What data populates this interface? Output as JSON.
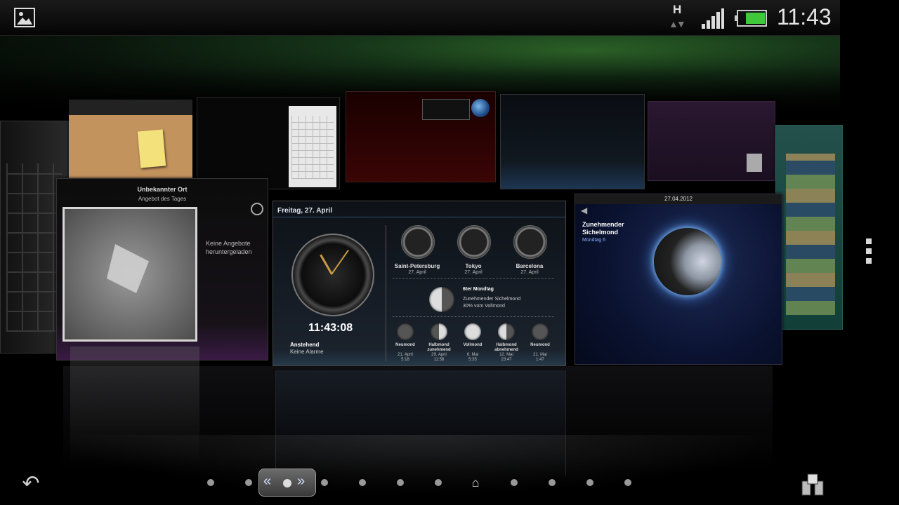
{
  "status_bar": {
    "network_type": "H",
    "time": "11:43"
  },
  "colors": {
    "battery": "#3ec83a",
    "accent_blue": "#5aa0ff"
  },
  "left_panel": {
    "title": "Unbekannter Ort",
    "subtitle": "Angebot des Tages",
    "message": "Keine Angebote heruntergeladen"
  },
  "clock_widget": {
    "date": "Freitag, 27. April",
    "time": "11:43:08",
    "upcoming_label": "Anstehend",
    "alarm_status": "Keine Alarme",
    "world_clocks": [
      {
        "city": "Saint-Petersburg",
        "date": "27. April"
      },
      {
        "city": "Tokyo",
        "date": "27. April"
      },
      {
        "city": "Barcelona",
        "date": "27. April"
      }
    ],
    "moon_today": {
      "day": "6ter Mondtag",
      "phase": "Zunehmender Sichelmond",
      "percent": "30% vom Vollmond"
    },
    "phases": [
      {
        "name": "Neumond",
        "date": "21. April",
        "time": "5:18"
      },
      {
        "name": "Halbmond zunehmend",
        "date": "29. April",
        "time": "11:58"
      },
      {
        "name": "Vollmond",
        "date": "6. Mai",
        "time": "5:35"
      },
      {
        "name": "Halbmond abnehmend",
        "date": "12. Mai",
        "time": "23:47"
      },
      {
        "name": "Neumond",
        "date": "21. Mai",
        "time": "1:47"
      }
    ]
  },
  "moon_panel": {
    "header_date": "27.04.2012",
    "title": "Zunehmender Sichelmond",
    "day": "Mondtag 6"
  }
}
